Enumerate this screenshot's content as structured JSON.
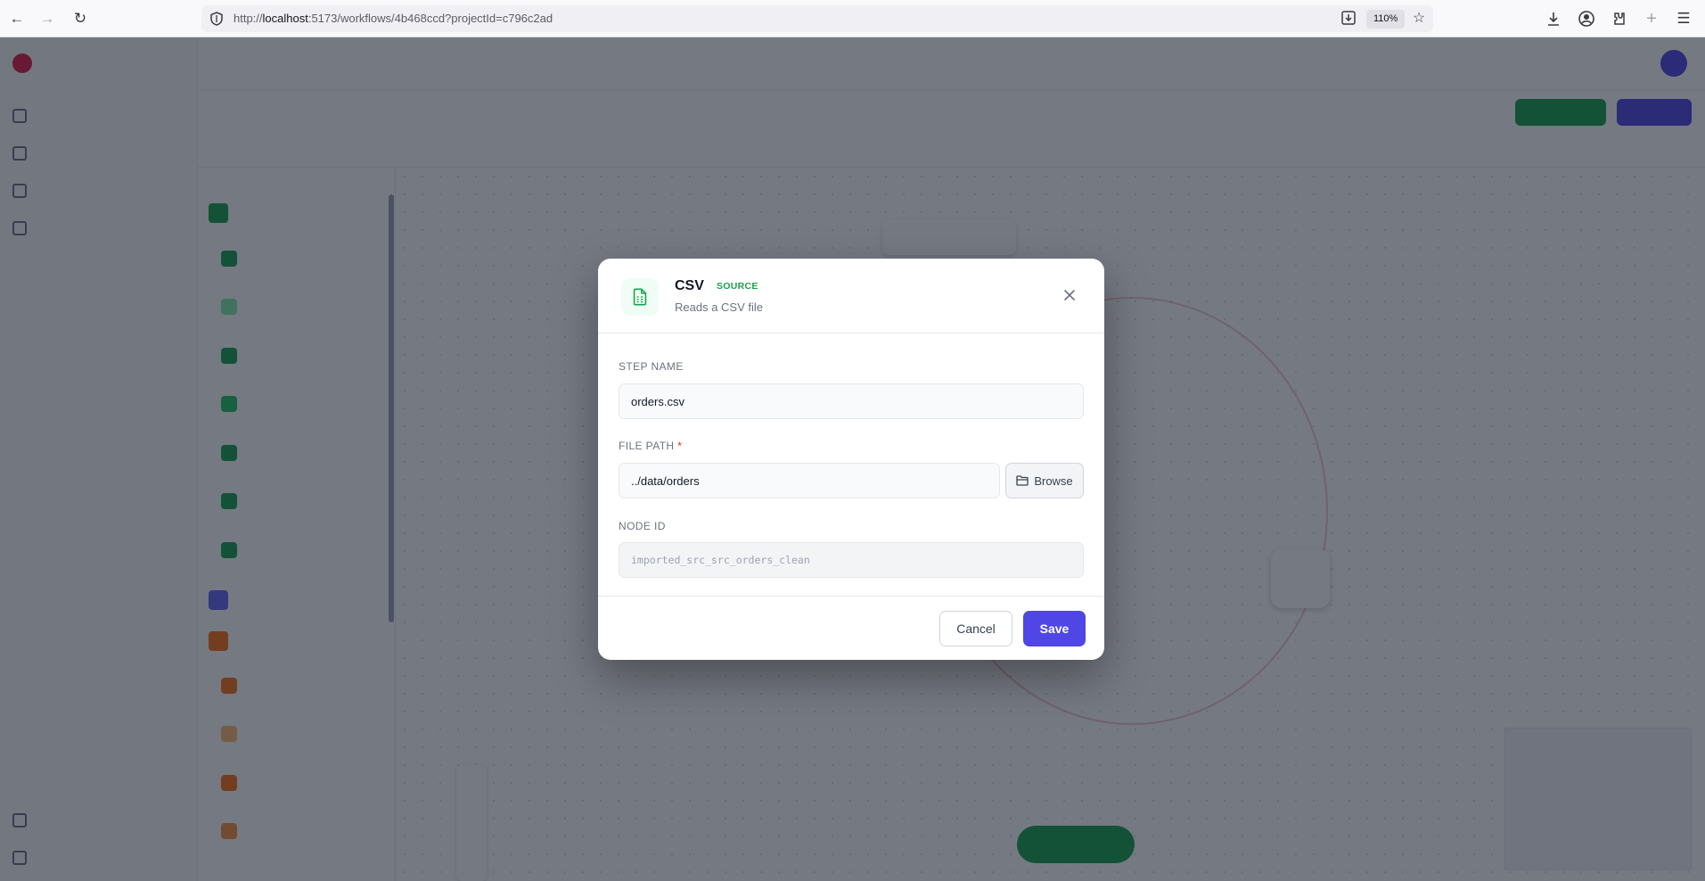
{
  "browser": {
    "url_prefix": "http://",
    "url_host": "localhost",
    "url_rest": ":5173/workflows/4b468ccd?projectId=c796c2ad",
    "zoom": "110%"
  },
  "modal": {
    "title": "CSV",
    "badge": "SOURCE",
    "subtitle": "Reads a CSV file",
    "step_name_label": "STEP NAME",
    "step_name_value": "orders.csv",
    "file_path_label": "FILE PATH",
    "file_path_required": "*",
    "file_path_value": "../data/orders",
    "browse_label": "Browse",
    "node_id_label": "NODE ID",
    "node_id_value": "imported_src_src_orders_clean",
    "cancel_label": "Cancel",
    "save_label": "Save"
  },
  "colors": {
    "accent": "#4f46e5",
    "source_green": "#16a34a",
    "required_red": "#dc2626",
    "overlay": "rgba(17,24,39,0.58)"
  },
  "icons": {
    "node": "csv-file-icon",
    "close": "close-icon",
    "browse": "folder-icon"
  }
}
